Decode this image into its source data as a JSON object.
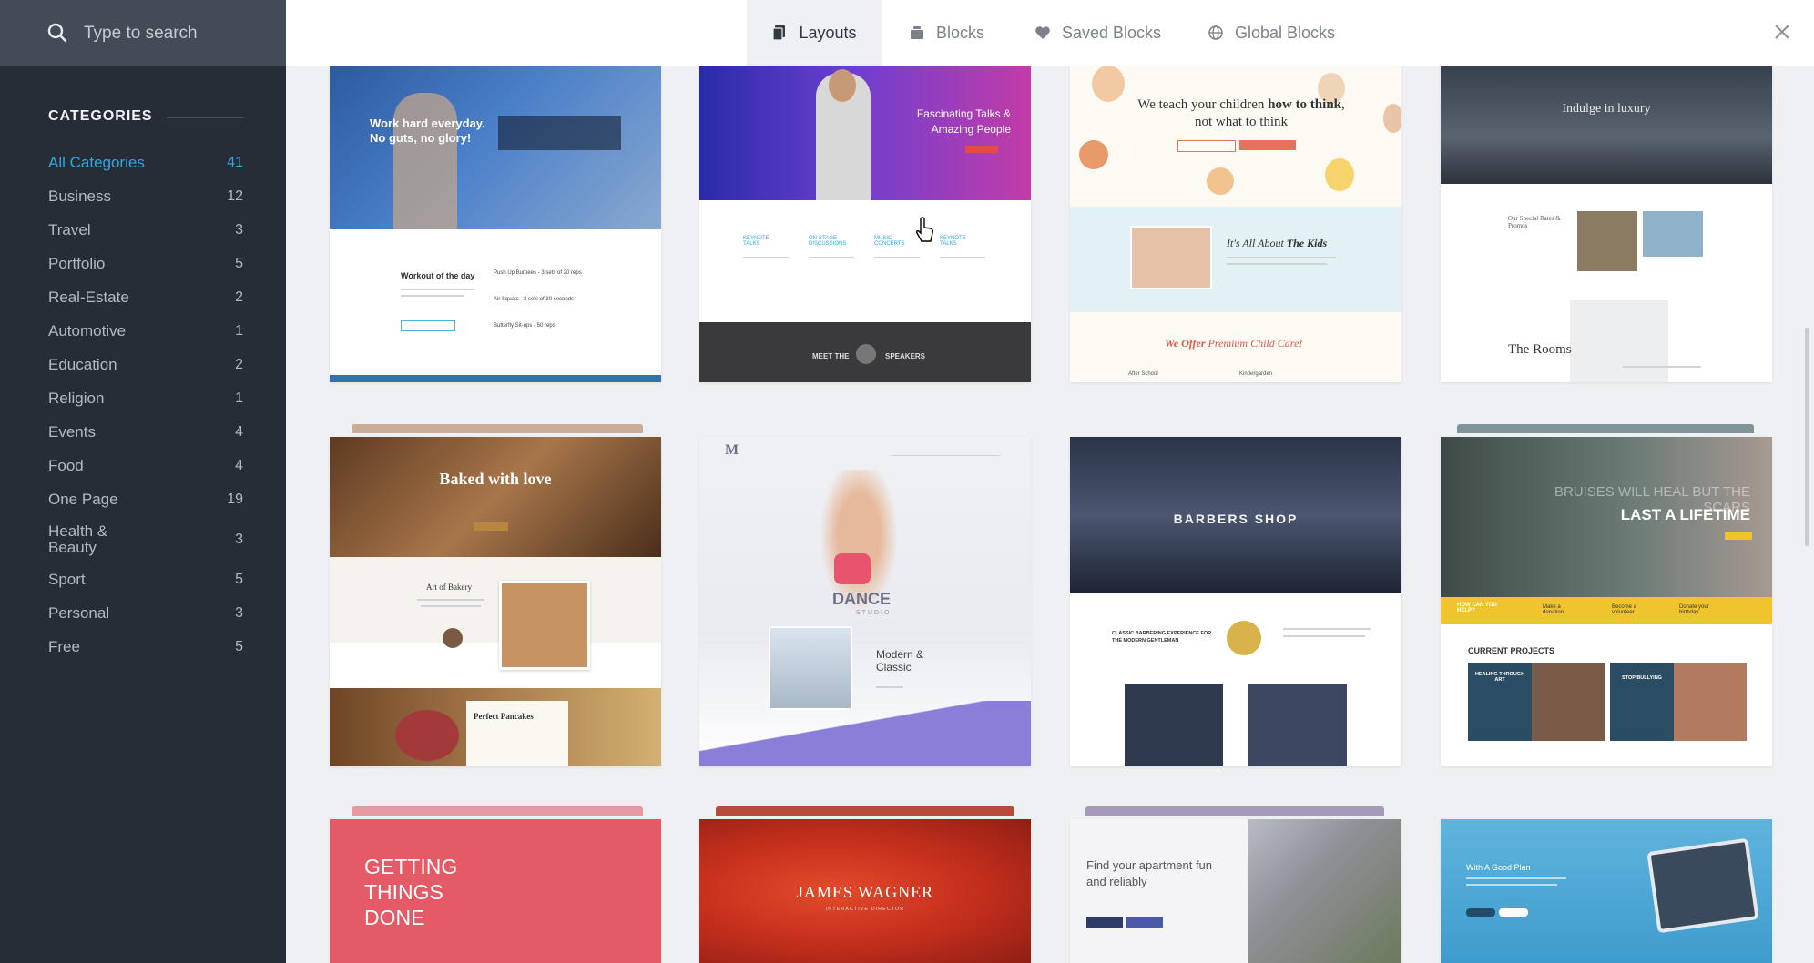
{
  "search": {
    "placeholder": "Type to search"
  },
  "sidebar": {
    "header": "CATEGORIES",
    "categories": [
      {
        "label": "All Categories",
        "count": "41"
      },
      {
        "label": "Business",
        "count": "12"
      },
      {
        "label": "Travel",
        "count": "3"
      },
      {
        "label": "Portfolio",
        "count": "5"
      },
      {
        "label": "Real-Estate",
        "count": "2"
      },
      {
        "label": "Automotive",
        "count": "1"
      },
      {
        "label": "Education",
        "count": "2"
      },
      {
        "label": "Religion",
        "count": "1"
      },
      {
        "label": "Events",
        "count": "4"
      },
      {
        "label": "Food",
        "count": "4"
      },
      {
        "label": "One Page",
        "count": "19"
      },
      {
        "label": "Health & Beauty",
        "count": "3"
      },
      {
        "label": "Sport",
        "count": "5"
      },
      {
        "label": "Personal",
        "count": "3"
      },
      {
        "label": "Free",
        "count": "5"
      }
    ]
  },
  "tabs": [
    {
      "label": "Layouts",
      "icon": "layouts-icon"
    },
    {
      "label": "Blocks",
      "icon": "blocks-icon"
    },
    {
      "label": "Saved Blocks",
      "icon": "heart-icon"
    },
    {
      "label": "Global Blocks",
      "icon": "globe-icon"
    }
  ],
  "colors": {
    "accent": "#2fa7e0",
    "sidebar": "#272d36",
    "search_bg": "#434b56"
  },
  "cards": {
    "fitness": {
      "hero": "Work hard everyday. No guts, no glory!",
      "section_title": "Workout of the day",
      "items": [
        "Push Up Burpees - 3 sets of 20 reps",
        "Air Squats - 3 sets of 30 seconds",
        "Butterfly Sit-ups - 50 reps"
      ]
    },
    "speakers": {
      "hero": "Fascinating Talks & Amazing People",
      "features": [
        "KEYNOTE TALKS",
        "ON-STAGE DISCUSSIONS",
        "MUSIC CONCERTS",
        "KEYNOTE TALKS"
      ],
      "footer_left": "MEET THE",
      "footer_right": "SPEAKERS"
    },
    "kids": {
      "hero_a": "We teach your children ",
      "hero_b": "how to think",
      "hero_c": ", not what to think",
      "about_a": "It's All About ",
      "about_b": "The Kids",
      "offer_a": "We Offer ",
      "offer_b": "Premium Child Care!",
      "items": [
        "After School",
        "Kindergarden"
      ]
    },
    "luxury": {
      "hero": "Indulge in luxury",
      "rooms": "The Rooms",
      "special": "Our Special Rates & Promos"
    },
    "bakery": {
      "hero": "Baked with love",
      "art": "Art of Bakery",
      "pancakes": "Perfect Pancakes"
    },
    "dance": {
      "logo": "M",
      "title": "DANCE",
      "sub": "STUDIO",
      "modern": "Modern & Classic"
    },
    "barbers": {
      "hero": "BARBERS SHOP",
      "tagline": "CLASSIC BARBERING EXPERIENCE FOR THE MODERN GENTLEMAN"
    },
    "charity": {
      "hero_a": "BRUISES WILL HEAL BUT THE SCARS",
      "hero_b": "LAST A LIFETIME",
      "help": "HOW CAN YOU HELP?",
      "actions": [
        "Make a donation",
        "Become a volunteer",
        "Donate your birthday"
      ],
      "projects": "CURRENT PROJECTS",
      "project_items": [
        "HEALING THROUGH ART",
        "STOP BULLYING"
      ]
    },
    "getting": {
      "text": "GETTING THINGS DONE"
    },
    "wagner": {
      "name": "JAMES WAGNER",
      "role": "INTERACTIVE DIRECTOR"
    },
    "apartment": {
      "text": "Find your apartment fun and reliably"
    },
    "plan": {
      "text": "With A Good Plan"
    }
  }
}
